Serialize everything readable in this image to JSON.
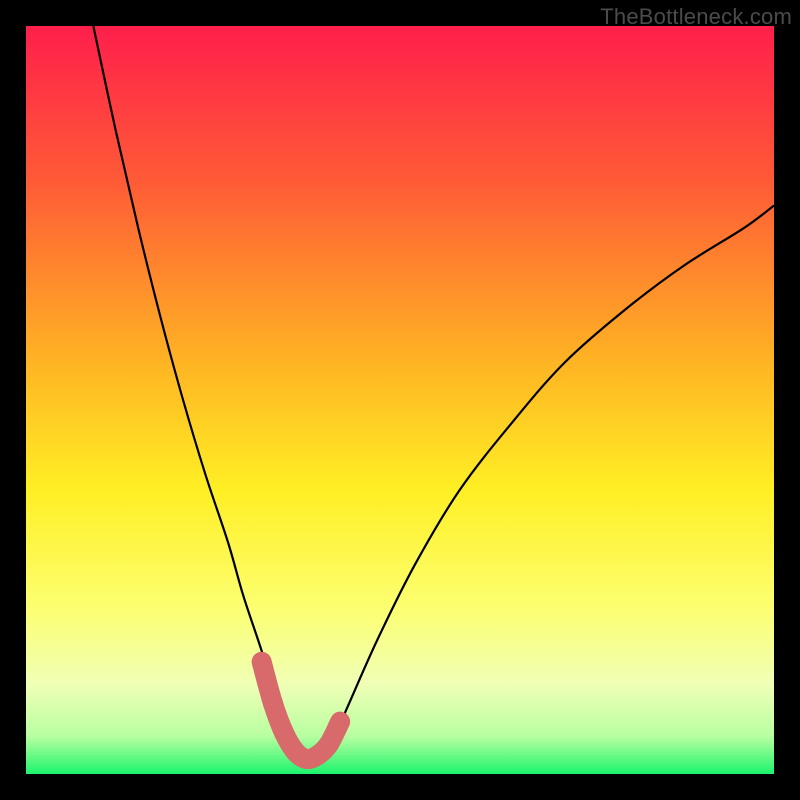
{
  "watermark": {
    "text": "TheBottleneck.com"
  },
  "colors": {
    "frame": "#000000",
    "gradient_stops": [
      {
        "pct": 0,
        "color": "#ff1f4b"
      },
      {
        "pct": 20,
        "color": "#ff5837"
      },
      {
        "pct": 45,
        "color": "#ffb423"
      },
      {
        "pct": 62,
        "color": "#ffef24"
      },
      {
        "pct": 78,
        "color": "#fcff72"
      },
      {
        "pct": 88,
        "color": "#f0ffb6"
      },
      {
        "pct": 95,
        "color": "#b7ffa0"
      },
      {
        "pct": 100,
        "color": "#1cf46d"
      }
    ],
    "curve": "#000000",
    "marker_fill": "#d86a6b",
    "marker_stroke": "#d86a6b"
  },
  "chart_data": {
    "type": "line",
    "title": "",
    "xlabel": "",
    "ylabel": "",
    "xlim": [
      0,
      100
    ],
    "ylim": [
      0,
      100
    ],
    "series": [
      {
        "name": "bottleneck-curve",
        "x": [
          9,
          12,
          15,
          18,
          21,
          24,
          27,
          29,
          31,
          33,
          35,
          36.5,
          38,
          39.5,
          41,
          43,
          47,
          52,
          58,
          65,
          72,
          80,
          88,
          96,
          100
        ],
        "y": [
          100,
          86,
          73,
          61,
          50,
          40,
          31,
          24,
          18,
          12,
          7,
          4,
          2,
          2.5,
          4.5,
          9,
          18,
          28,
          38,
          47,
          55,
          62,
          68,
          73,
          76
        ]
      }
    ],
    "markers": {
      "name": "highlighted-range",
      "x": [
        31.5,
        33,
        34.5,
        36,
        37.5,
        39,
        40.5,
        42
      ],
      "y": [
        15,
        9.5,
        5.5,
        3,
        2,
        2.5,
        4,
        7
      ],
      "radius_default": 10,
      "radii": [
        9,
        10,
        10,
        10,
        10,
        10,
        10,
        7
      ]
    }
  }
}
